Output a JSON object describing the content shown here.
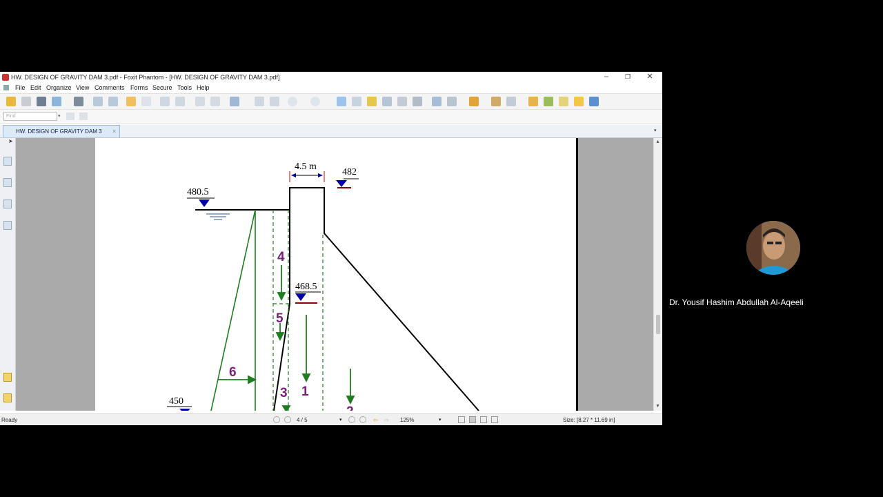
{
  "window": {
    "title": "HW. DESIGN OF GRAVITY DAM 3.pdf - Foxit Phantom - [HW. DESIGN OF GRAVITY DAM 3.pdf]",
    "minimize": "–",
    "restore": "❐",
    "close": "✕"
  },
  "menu": [
    "File",
    "Edit",
    "Organize",
    "View",
    "Comments",
    "Forms",
    "Secure",
    "Tools",
    "Help"
  ],
  "find": {
    "placeholder": "Find"
  },
  "tab": {
    "label": "HW. DESIGN OF GRAVITY DAM 3",
    "close": "×"
  },
  "drawing": {
    "crest_width": "4.5 m",
    "crest_elev": "482",
    "upstream_wl": "480.5",
    "downstream_mark": "468.5",
    "tailwater": "450",
    "forces": [
      "4",
      "5",
      "6",
      "3",
      "1",
      "2"
    ]
  },
  "status": {
    "ready": "Ready",
    "page": "4 / 5",
    "zoom": "125%",
    "size": "Size: [8.27 * 11.69 in]"
  },
  "participant": {
    "name": "Dr. Yousif Hashim Abdullah Al-Aqeeli"
  },
  "colors": {
    "force": "#1e7d1e",
    "label": "#7a1f7a",
    "marker": "#0000a0",
    "level_line": "#8b0000"
  }
}
